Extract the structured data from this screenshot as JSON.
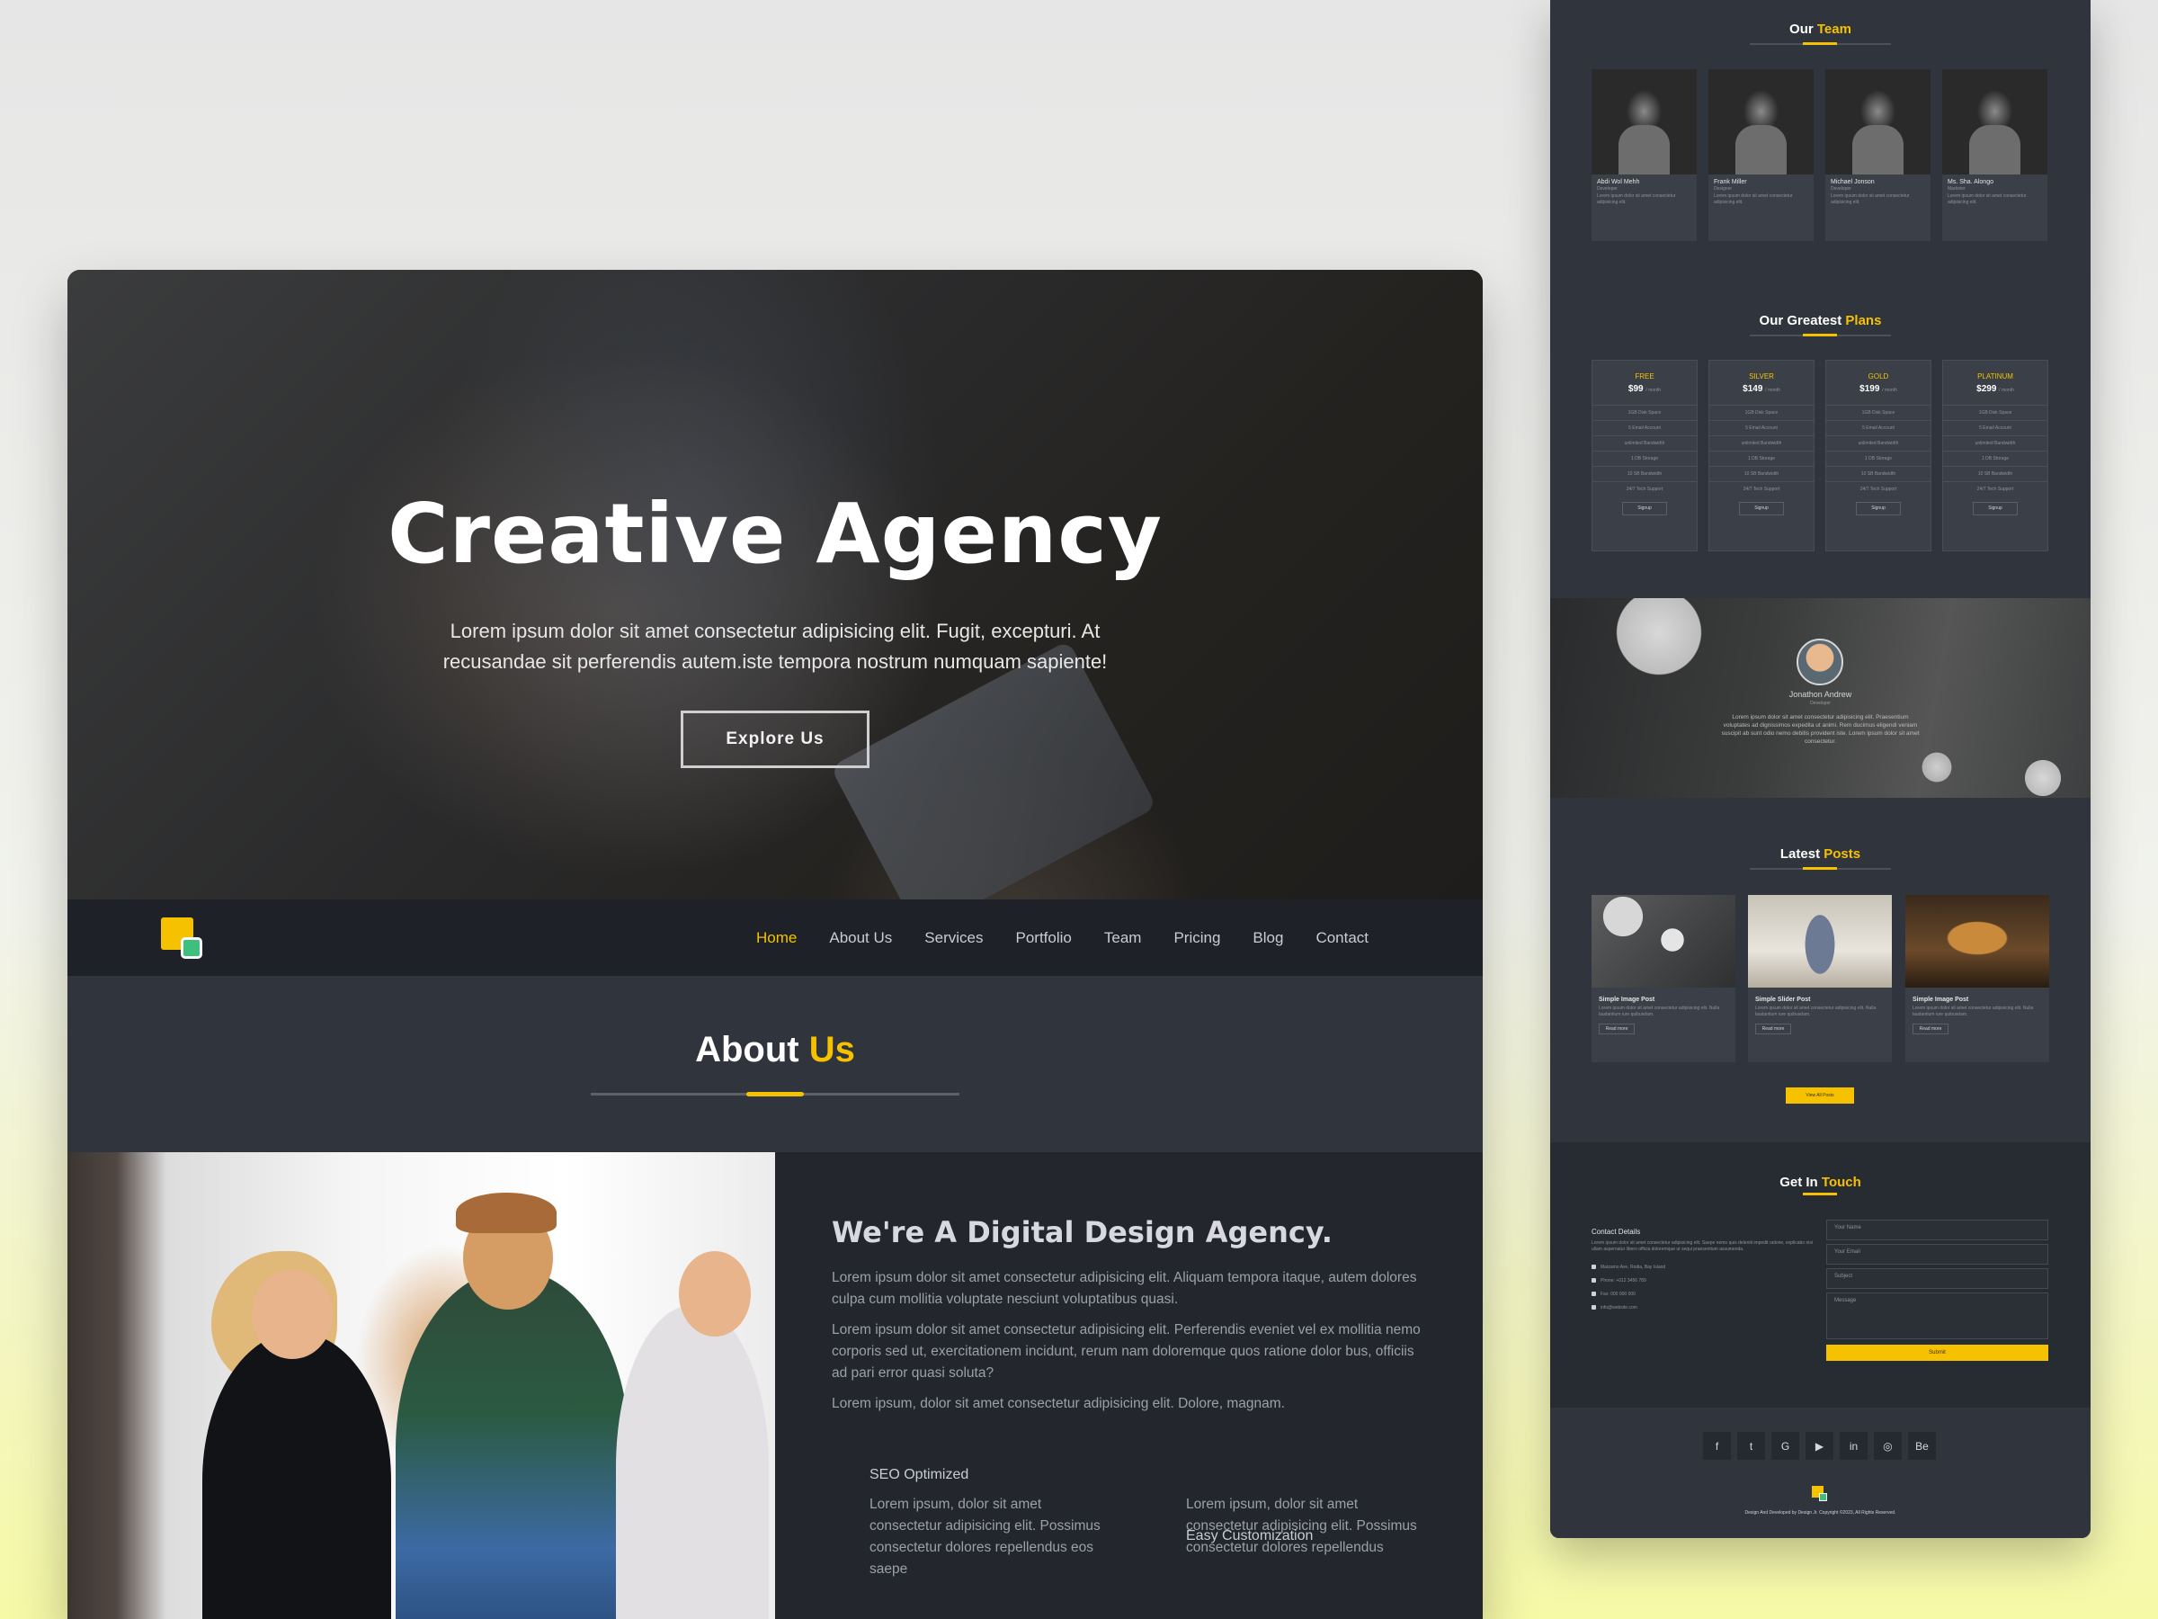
{
  "hero": {
    "title": "Creative Agency",
    "subtitle": "Lorem ipsum dolor sit amet consectetur adipisicing elit. Fugit, excepturi. At recusandae sit perferendis autem.iste tempora nostrum numquam sapiente!",
    "cta_label": "Explore Us"
  },
  "nav": {
    "items": [
      "Home",
      "About Us",
      "Services",
      "Portfolio",
      "Team",
      "Pricing",
      "Blog",
      "Contact"
    ],
    "active": "Home"
  },
  "about": {
    "title_plain": "About",
    "title_accent": "Us",
    "heading": "We're A Digital Design Agency.",
    "paragraphs": [
      "Lorem ipsum dolor sit amet consectetur adipisicing elit. Aliquam tempora itaque, autem dolores culpa cum mollitia voluptate nesciunt voluptatibus quasi.",
      "Lorem ipsum dolor sit amet consectetur adipisicing elit. Perferendis eveniet vel ex mollitia nemo corporis sed ut, exercitationem incidunt, rerum nam doloremque quos ratione dolor bus, officiis ad pari error quasi soluta?",
      "Lorem ipsum, dolor sit amet consectetur adipisicing elit. Dolore, magnam."
    ],
    "features": [
      {
        "title": "SEO Optimized",
        "text": "Lorem ipsum, dolor sit amet consectetur adipisicing elit. Possimus consectetur dolores repellendus eos saepe"
      },
      {
        "title": "Easy Customization",
        "text": "Lorem ipsum, dolor sit amet consectetur adipisicing elit. Possimus consectetur dolores repellendus"
      }
    ]
  },
  "team": {
    "title_plain": "Our",
    "title_accent": "Team",
    "members": [
      {
        "name": "Abdi Wol Mehh",
        "role": "Developer",
        "text": "Lorem ipsum dolor sit amet consectetur adipisicing elit."
      },
      {
        "name": "Frank Miller",
        "role": "Designer",
        "text": "Lorem ipsum dolor sit amet consectetur adipisicing elit."
      },
      {
        "name": "Michael Jonson",
        "role": "Developer",
        "text": "Lorem ipsum dolor sit amet consectetur adipisicing elit."
      },
      {
        "name": "Ms. Sha. Alongo",
        "role": "Marketer",
        "text": "Lorem ipsum dolor sit amet consectetur adipisicing elit."
      }
    ]
  },
  "plans": {
    "title_plain": "Our Greatest",
    "title_accent": "Plans",
    "per": "/ month",
    "features": [
      "1GB Disk Space",
      "5 Email Account",
      "unlimited Bandwidth",
      "1 DB Storage",
      "10 SB Bandwidth",
      "24/7 Tech Support"
    ],
    "button_label": "Signup",
    "items": [
      {
        "name": "FREE",
        "price": "$99"
      },
      {
        "name": "SILVER",
        "price": "$149"
      },
      {
        "name": "GOLD",
        "price": "$199"
      },
      {
        "name": "PLATINUM",
        "price": "$299"
      }
    ]
  },
  "testimonial": {
    "name": "Jonathon Andrew",
    "role": "Developer",
    "text": "Lorem ipsum dolor sit amet consectetur adipisicing elit. Praesentium voluptates ad dignissimos expedita ut animi. Rem ducimus eligendi veniam suscipit ab sunt odio nemo debitis provident iste. Lorem ipsum dolor sit amet consectetur."
  },
  "posts": {
    "title_plain": "Latest",
    "title_accent": "Posts",
    "read_more": "Read more",
    "view_all": "View All Posts",
    "items": [
      {
        "title": "Simple Image Post",
        "text": "Lorem ipsum dolor sit amet consectetur adipisicing elit. Nulla laudantium iure quibusdam."
      },
      {
        "title": "Simple Slider Post",
        "text": "Lorem ipsum dolor sit amet consectetur adipisicing elit. Nulla laudantium iure quibusdam."
      },
      {
        "title": "Simple Image Post",
        "text": "Lorem ipsum dolor sit amet consectetur adipisicing elit. Nulla laudantium iure quibusdam."
      }
    ]
  },
  "contact": {
    "title_plain": "Get In",
    "title_accent": "Touch",
    "details_title": "Contact Details",
    "details_text": "Lorem ipsum dolor sit amet consectetur adipisicing elit. Saepe nemo quis deleniti impedit ratione, explicabo nisi ullam aspernatur libero officia doloremque ut sequi praesentium assumenda.",
    "address": "Matzamo Ave, Rodia, Bay Island",
    "phone": "Phone: +012 3456 789",
    "fax": "Fax: 000 000 000",
    "email": "info@website.com",
    "placeholders": {
      "name": "Your Name",
      "email": "Your Email",
      "subject": "Subject",
      "message": "Message"
    },
    "submit_label": "Submit"
  },
  "footer": {
    "social_icons": [
      "facebook-icon",
      "twitter-icon",
      "google-icon",
      "youtube-icon",
      "linkedin-icon",
      "dribbble-icon",
      "behance-icon"
    ],
    "social_glyphs": [
      "f",
      "t",
      "G",
      "▶",
      "in",
      "◎",
      "Be"
    ],
    "copyright": "Design And Developed by Design Jr. Copyright ©2023, All Rights Reserved."
  },
  "colors": {
    "accent": "#f6c200",
    "logo_green": "#3ec07c",
    "background_dark": "#2f343d",
    "navbar": "#1e2228"
  }
}
